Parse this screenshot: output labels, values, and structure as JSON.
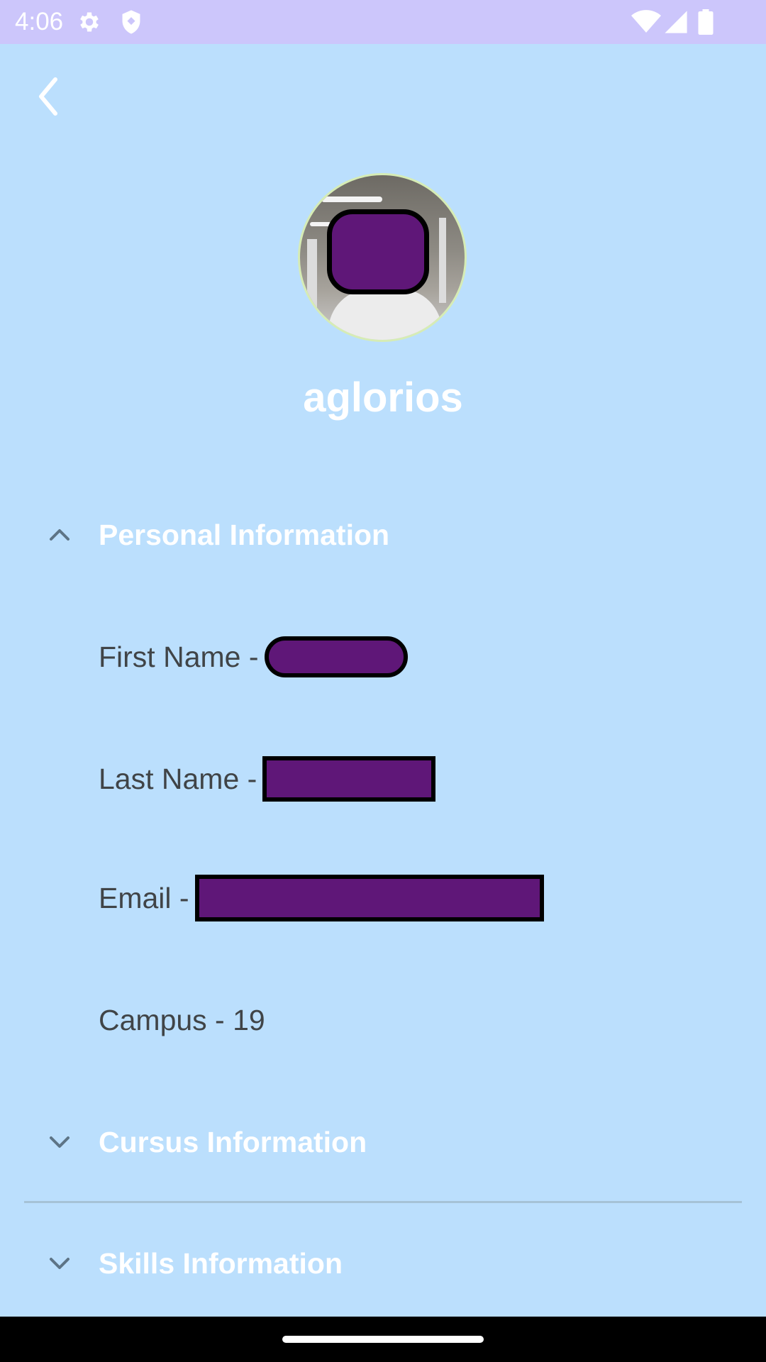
{
  "status_bar": {
    "time": "4:06",
    "left_icons": [
      "gear-icon",
      "shield-icon"
    ],
    "right_icons": [
      "wifi-icon",
      "signal-icon",
      "battery-icon"
    ]
  },
  "profile": {
    "username": "aglorios"
  },
  "sections": {
    "personal": {
      "title": "Personal Information",
      "expanded": true,
      "fields": {
        "first_name_label": "First Name - ",
        "last_name_label": "Last Name - ",
        "email_label": "Email - ",
        "campus_label": "Campus - 19"
      }
    },
    "cursus": {
      "title": "Cursus Information",
      "expanded": false
    },
    "skills": {
      "title": "Skills Information",
      "expanded": false
    }
  },
  "colors": {
    "background": "#bbdffd",
    "status_bar": "#ccc6fb",
    "redaction_fill": "#5f1778",
    "field_text": "#404447",
    "header_text": "#ffffff"
  }
}
